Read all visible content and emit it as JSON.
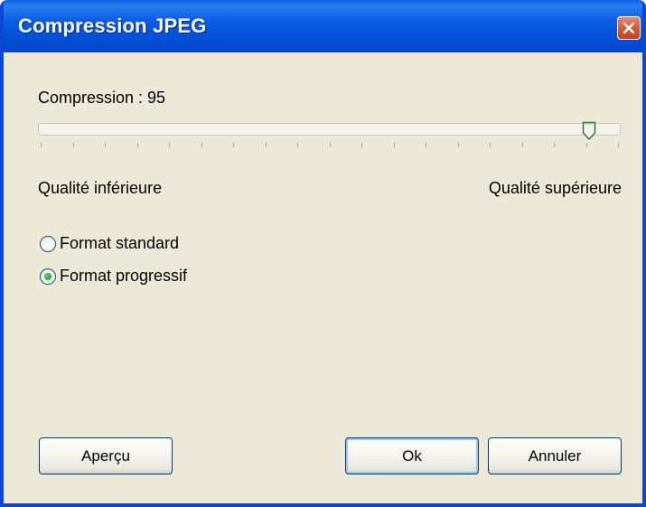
{
  "window": {
    "title": "Compression JPEG",
    "close_icon": "close-icon",
    "colors": {
      "titlebar": "#0a5fe0",
      "close_button": "#d45a38",
      "client_background": "#ece9d8"
    }
  },
  "compression": {
    "label": "Compression : 95",
    "value": 95,
    "min": 0,
    "max": 100,
    "tick_count": 19,
    "low_label": "Qualité inférieure",
    "high_label": "Qualité supérieure"
  },
  "format": {
    "options": [
      {
        "label": "Format standard",
        "selected": false
      },
      {
        "label": "Format progressif",
        "selected": true
      }
    ],
    "selected_color": "#2aa52a"
  },
  "buttons": {
    "preview_label": "Aperçu",
    "ok_label": "Ok",
    "cancel_label": "Annuler"
  }
}
